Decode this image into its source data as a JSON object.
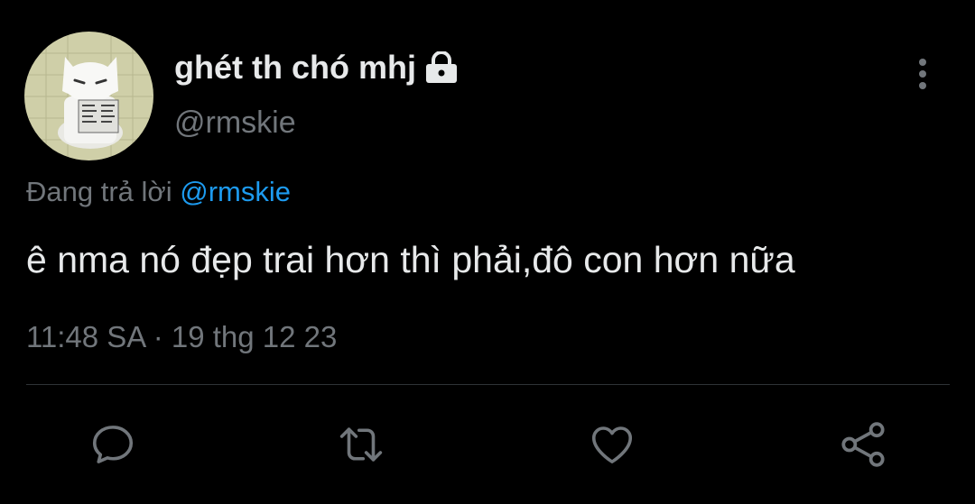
{
  "author": {
    "display_name": "ghét th chó mhj",
    "handle": "@rmskie",
    "avatar_icon": "avatar-cat-reading-newspaper",
    "protected_icon": "lock-icon"
  },
  "reply_context": {
    "prefix": "Đang trả lời ",
    "mention": "@rmskie"
  },
  "tweet": {
    "text": "ê nma nó đẹp trai hơn thì phải,đô con hơn nữa",
    "time": "11:48 SA",
    "separator": "·",
    "date": "19 thg 12 23"
  },
  "actions": [
    {
      "name": "reply",
      "icon": "speech-bubble-icon"
    },
    {
      "name": "retweet",
      "icon": "retweet-icon"
    },
    {
      "name": "like",
      "icon": "heart-icon"
    },
    {
      "name": "share",
      "icon": "share-icon"
    }
  ],
  "colors": {
    "background": "#000000",
    "text_primary": "#e7e9ea",
    "text_secondary": "#71767b",
    "accent": "#1d9bf0",
    "divider": "#2f3336"
  }
}
